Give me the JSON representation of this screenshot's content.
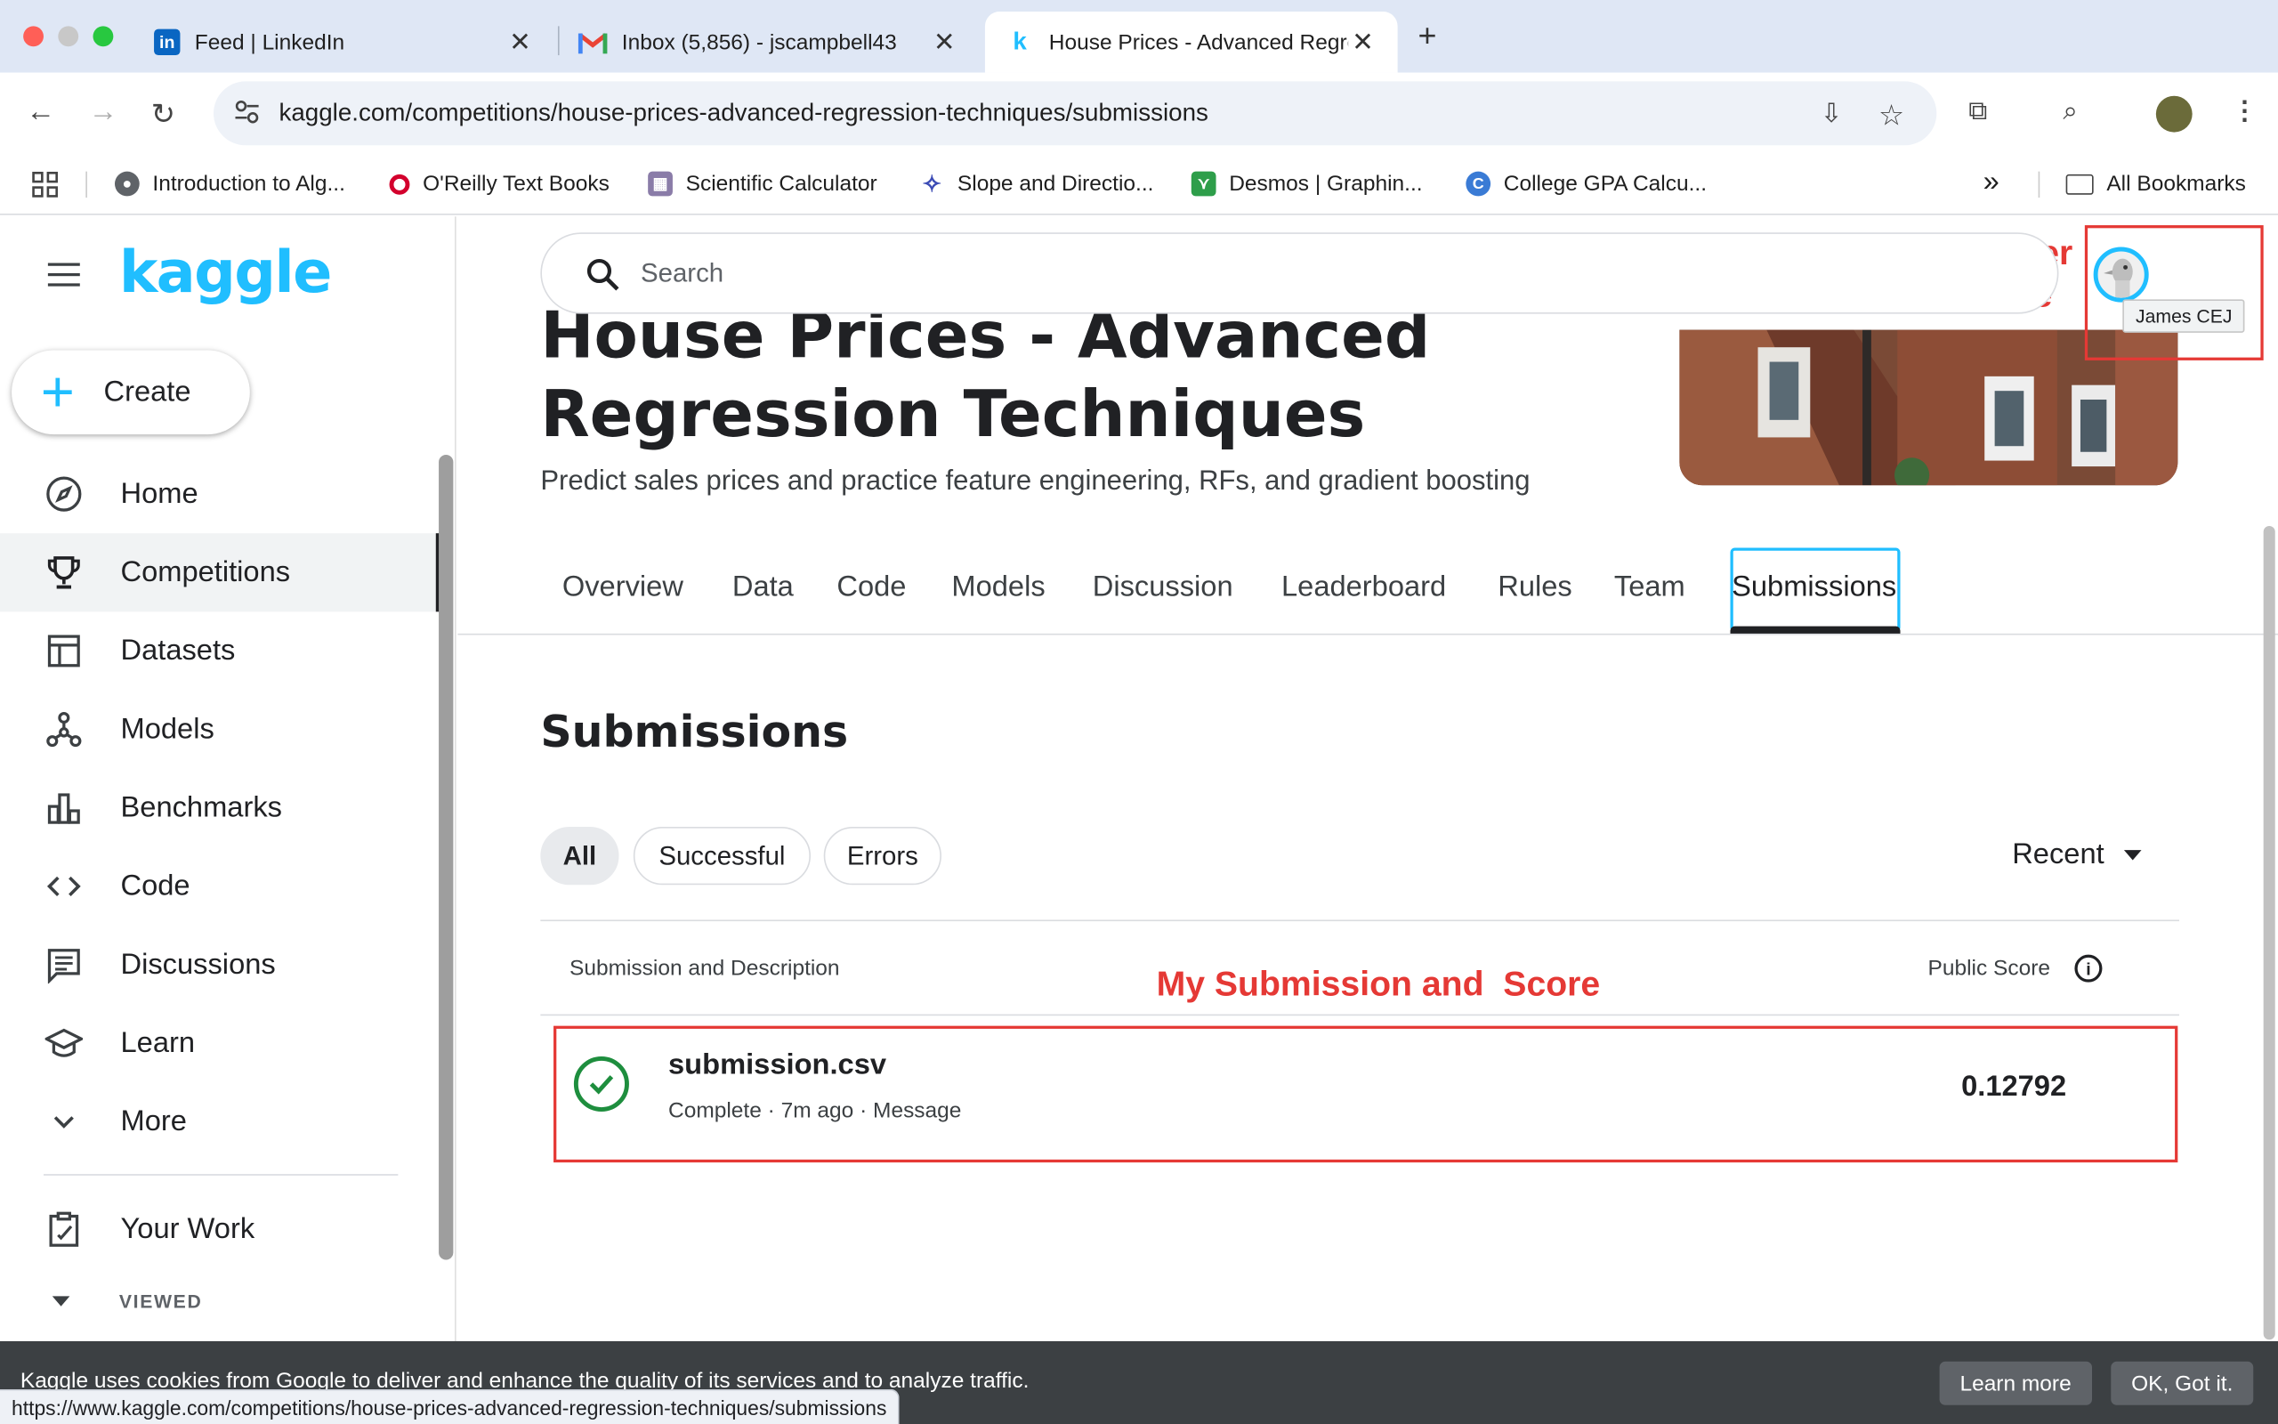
{
  "browser": {
    "tabs": [
      {
        "title": "Feed | LinkedIn",
        "favicon": "linkedin-icon"
      },
      {
        "title": "Inbox (5,856) - jscampbell43",
        "favicon": "gmail-icon"
      },
      {
        "title": "House Prices - Advanced Regression Techniques",
        "favicon": "kaggle-k-icon"
      }
    ],
    "url": "kaggle.com/competitions/house-prices-advanced-regression-techniques/submissions",
    "bookmarks": [
      "Introduction to Alg...",
      "O'Reilly Text Books",
      "Scientific Calculator",
      "Slope and Directio...",
      "Desmos | Graphin...",
      "College GPA Calcu..."
    ],
    "all_bookmarks": "All Bookmarks",
    "more_bookmarks": "»"
  },
  "sidebar": {
    "logo": "kaggle",
    "create_label": "Create",
    "items": [
      {
        "label": "Home",
        "icon": "compass-icon"
      },
      {
        "label": "Competitions",
        "icon": "trophy-icon"
      },
      {
        "label": "Datasets",
        "icon": "table-icon"
      },
      {
        "label": "Models",
        "icon": "models-icon"
      },
      {
        "label": "Benchmarks",
        "icon": "bar-chart-icon"
      },
      {
        "label": "Code",
        "icon": "code-icon"
      },
      {
        "label": "Discussions",
        "icon": "comment-icon"
      },
      {
        "label": "Learn",
        "icon": "school-icon"
      },
      {
        "label": "More",
        "icon": "chevron-down-icon"
      }
    ],
    "your_work": "Your Work",
    "viewed": "VIEWED"
  },
  "search": {
    "placeholder": "Search"
  },
  "competition": {
    "title_line1": "House Prices - Advanced",
    "title_line2": "Regression Techniques",
    "subtitle": "Predict sales prices and practice feature engineering, RFs, and gradient boosting"
  },
  "tabs": [
    "Overview",
    "Data",
    "Code",
    "Models",
    "Discussion",
    "Leaderboard",
    "Rules",
    "Team",
    "Submissions"
  ],
  "submissions": {
    "heading": "Submissions",
    "filters": [
      "All",
      "Successful",
      "Errors"
    ],
    "sort": "Recent",
    "col_submission": "Submission and Description",
    "col_score": "Public Score",
    "rows": [
      {
        "file": "submission.csv",
        "meta": "Complete · 7m ago · Message",
        "score": "0.12792"
      }
    ]
  },
  "annotations": {
    "user_name_line1": "My User",
    "user_name_line2": "Name",
    "submission_note": "My Submission and  Score",
    "color": "#e53935"
  },
  "user": {
    "tooltip": "James CEJ"
  },
  "cookie": {
    "text": "Kaggle uses cookies from Google to deliver and enhance the quality of its services and to analyze traffic.",
    "learn_more": "Learn more",
    "ok": "OK, Got it."
  },
  "status_url": "https://www.kaggle.com/competitions/house-prices-advanced-regression-techniques/submissions"
}
